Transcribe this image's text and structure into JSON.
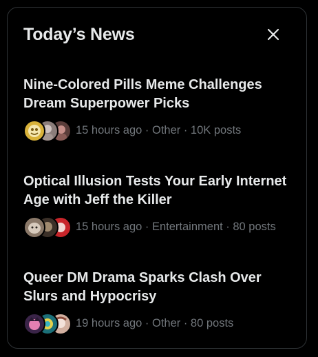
{
  "panel": {
    "title": "Today’s News",
    "close_label": "Close"
  },
  "news": [
    {
      "title": "Nine-Colored Pills Meme Challenges Dream Superpower Picks",
      "meta": "15 hours ago · Other · 10K posts",
      "avatars": [
        {
          "bg": "#d9b23a",
          "fg": "#f5e7b0"
        },
        {
          "bg": "#8b7d7a",
          "fg": "#cfc3c0"
        },
        {
          "bg": "#5a3d3a",
          "fg": "#c7908a"
        }
      ]
    },
    {
      "title": "Optical Illusion Tests Your Early Internet Age with Jeff the Killer",
      "meta": "15 hours ago · Entertainment · 80 posts",
      "avatars": [
        {
          "bg": "#8a7868",
          "fg": "#d8cbbd"
        },
        {
          "bg": "#3b3028",
          "fg": "#a08a6f"
        },
        {
          "bg": "#c8252a",
          "fg": "#f2d6d2"
        }
      ]
    },
    {
      "title": "Queer DM Drama Sparks Clash Over Slurs and Hypocrisy",
      "meta": "19 hours ago · Other · 80 posts",
      "avatars": [
        {
          "bg": "#3a2448",
          "fg": "#e37fb2"
        },
        {
          "bg": "#1b6f78",
          "fg": "#e4d24c"
        },
        {
          "bg": "#d2b0a0",
          "fg": "#f3e2da"
        }
      ]
    }
  ],
  "colors": {
    "background": "#000000",
    "border": "#2f3336",
    "primary_text": "#e7e9ea",
    "secondary_text": "#71767b"
  }
}
